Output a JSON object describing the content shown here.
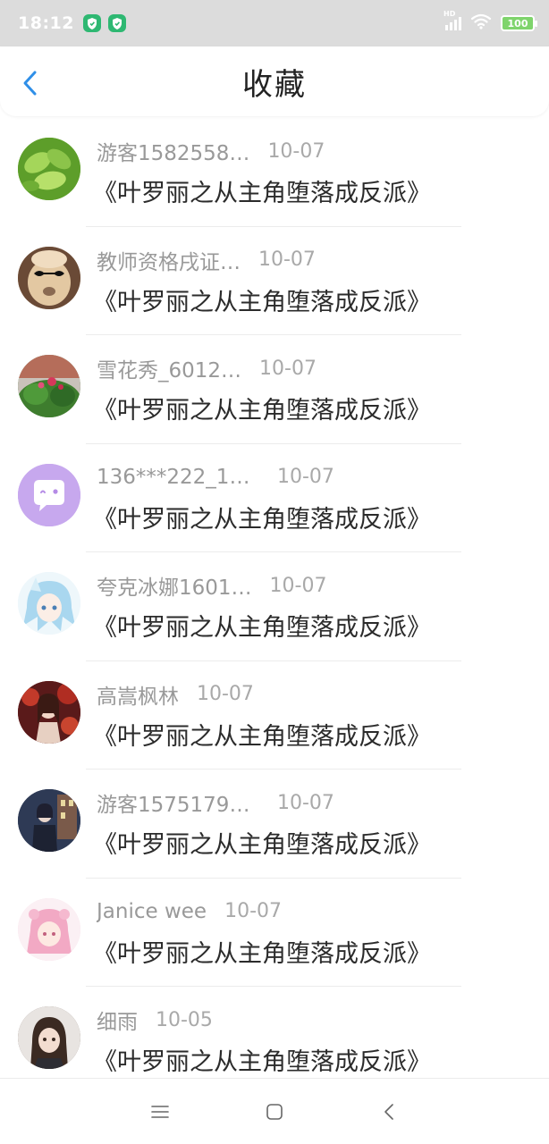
{
  "status_bar": {
    "time": "18:12",
    "battery": "100",
    "network": "HD"
  },
  "header": {
    "title": "收藏"
  },
  "items": [
    {
      "user": "游客1582558…",
      "date": "10-07",
      "title": "《叶罗丽之从主角堕落成反派》",
      "avatar": "green-leaf-avatar",
      "color": "#7fbf3a"
    },
    {
      "user": "教师资格戌证…",
      "date": "10-07",
      "title": "《叶罗丽之从主角堕落成反派》",
      "avatar": "alpaca-sunglasses-avatar",
      "color": "#c8a27a"
    },
    {
      "user": "雪花秀_6012…",
      "date": "10-07",
      "title": "《叶罗丽之从主角堕落成反派》",
      "avatar": "flower-bush-avatar",
      "color": "#3d7a34"
    },
    {
      "user": "136***222_19…",
      "date": "10-07",
      "title": "《叶罗丽之从主角堕落成反派》",
      "avatar": "chat-bubble-avatar",
      "color": "#c7a8ee"
    },
    {
      "user": "夸克冰娜1601…",
      "date": "10-07",
      "title": "《叶罗丽之从主角堕落成反派》",
      "avatar": "anime-blue-hair-avatar",
      "color": "#bfe3f3"
    },
    {
      "user": "高嵩枫林",
      "date": "10-07",
      "title": "《叶罗丽之从主角堕落成反派》",
      "avatar": "anime-red-scene-avatar",
      "color": "#8b2a2a"
    },
    {
      "user": "游客15751796…",
      "date": "10-07",
      "title": "《叶罗丽之从主角堕落成反派》",
      "avatar": "anime-street-avatar",
      "color": "#3a4866"
    },
    {
      "user": "Janice wee",
      "date": "10-07",
      "title": "《叶罗丽之从主角堕落成反派》",
      "avatar": "pink-hair-girl-avatar",
      "color": "#f6d6e4"
    },
    {
      "user": "细雨",
      "date": "10-05",
      "title": "《叶罗丽之从主角堕落成反派》",
      "avatar": "dark-hair-doll-avatar",
      "color": "#6b5a52"
    }
  ],
  "nav_bar": {
    "menu": "menu-icon",
    "home": "home-square-icon",
    "back": "back-chevron-icon"
  }
}
